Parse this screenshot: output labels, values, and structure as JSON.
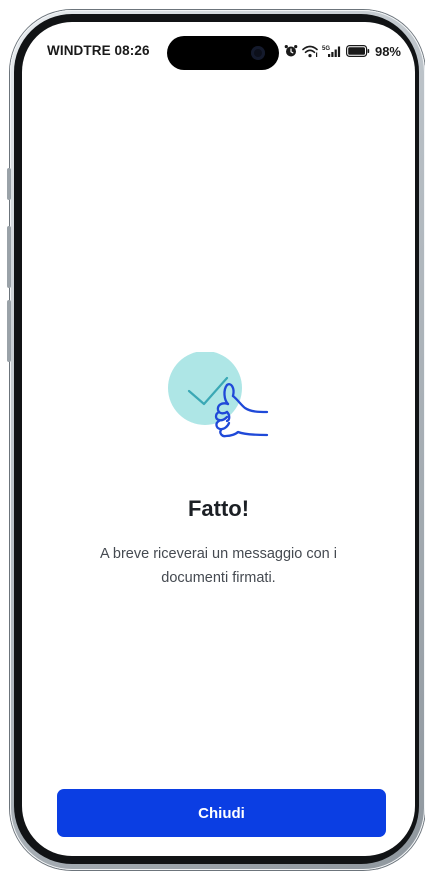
{
  "status_bar": {
    "carrier_time": "WINDTRE 08:26",
    "battery": "98%",
    "icons": [
      "alarm-icon",
      "wifi-icon",
      "signal-5g-icon",
      "battery-icon"
    ]
  },
  "illustration": {
    "icon": "thumbs-up-check-icon",
    "circle_color": "#aee6e6",
    "line_color": "#1f49d8"
  },
  "content": {
    "title": "Fatto!",
    "message": "A breve riceverai un messaggio con i documenti firmati."
  },
  "actions": {
    "close_label": "Chiudi",
    "button_color": "#0b3ee3"
  }
}
